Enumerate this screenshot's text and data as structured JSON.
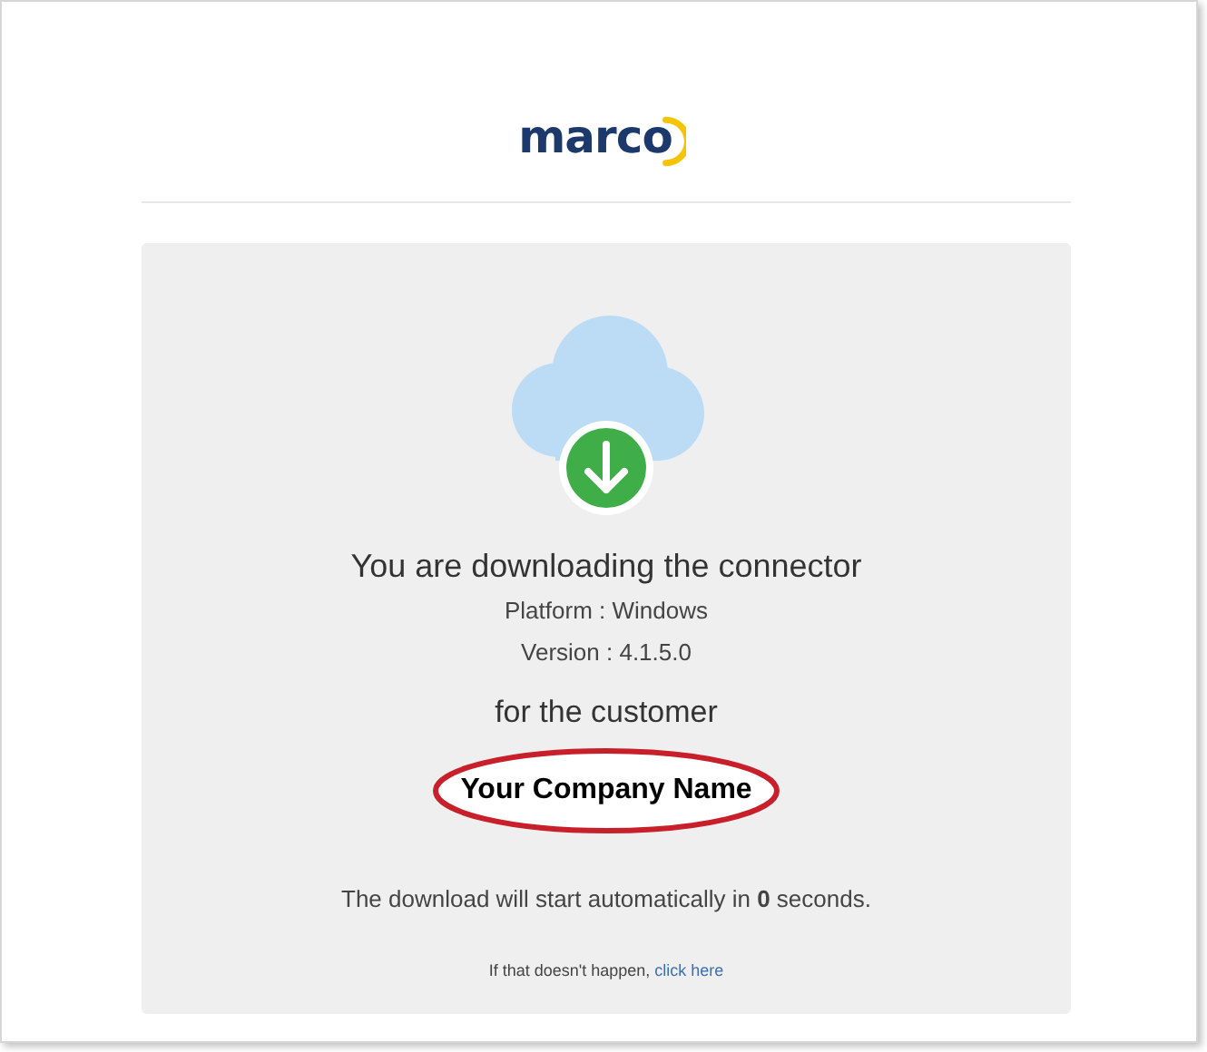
{
  "logo": {
    "text": "marco"
  },
  "download": {
    "heading": "You are downloading the connector",
    "platform": "Platform : Windows",
    "version": "Version : 4.1.5.0",
    "for_label": "for the customer",
    "customer": "Your Company Name",
    "customer_highlighted": true,
    "countdown": "The download will start automatically in **0** seconds.",
    "fallback": {
      "text": "If that doesn't happen,",
      "link": "click here"
    }
  }
}
